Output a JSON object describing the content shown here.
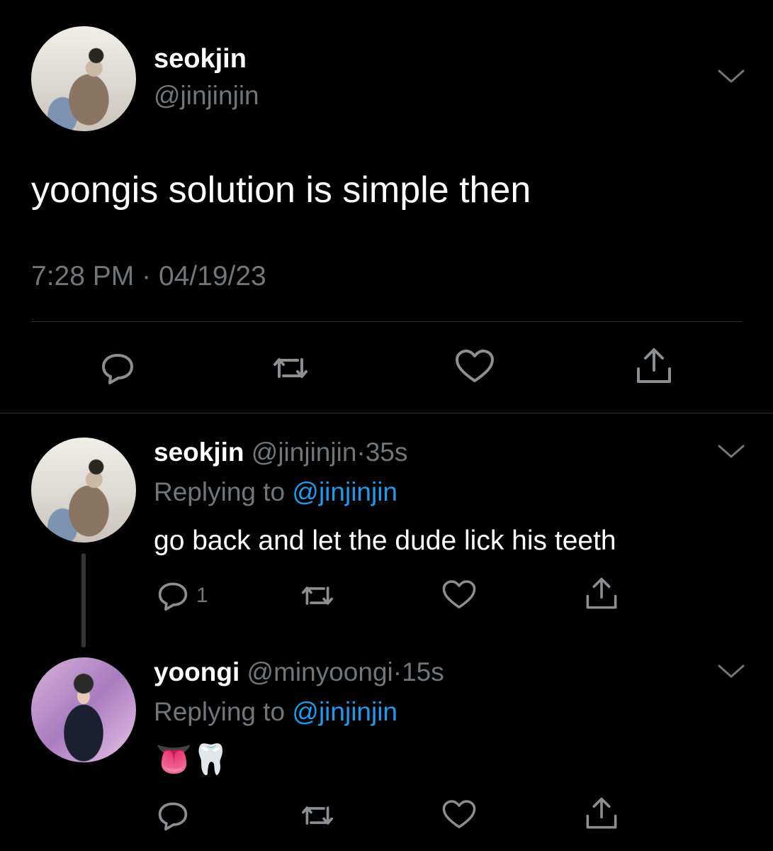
{
  "main_tweet": {
    "display_name": "seokjin",
    "handle": "@jinjinjin",
    "text": "yoongis solution is simple then",
    "time": "7:28 PM",
    "date_separator": "·",
    "date": "04/19/23"
  },
  "replies": [
    {
      "display_name": "seokjin",
      "handle": "@jinjinjin",
      "age": "35s",
      "replying_label": "Replying to",
      "replying_handle": "@jinjinjin",
      "text": "go back and let the dude lick his teeth",
      "reply_count": "1"
    },
    {
      "display_name": "yoongi",
      "handle": "@minyoongi",
      "age": "15s",
      "replying_label": "Replying to",
      "replying_handle": "@jinjinjin",
      "text": "👅🦷"
    }
  ],
  "meta_separator": "·",
  "colors": {
    "background": "#000000",
    "text": "#e7e9ea",
    "muted": "#71767b",
    "link": "#1d9bf0",
    "divider": "#2f3336"
  },
  "icons": [
    "chevron-down-icon",
    "reply-icon",
    "retweet-icon",
    "like-icon",
    "share-icon"
  ]
}
